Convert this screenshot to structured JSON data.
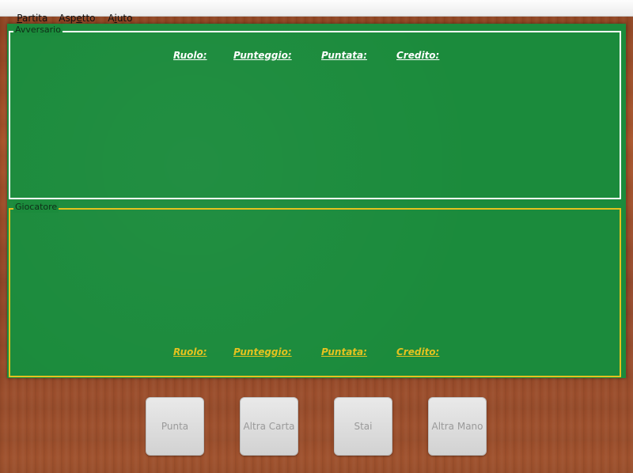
{
  "menu": {
    "partita": {
      "mnemonic": "P",
      "rest": "artita"
    },
    "aspetto": {
      "pre": "Asp",
      "mnemonic": "e",
      "post": "tto"
    },
    "aiuto": {
      "pre": "A",
      "mnemonic": "i",
      "post": "uto"
    }
  },
  "opponent": {
    "title": "Avversario",
    "stats": {
      "ruolo": "Ruolo:",
      "punteggio": "Punteggio:",
      "puntata": "Puntata:",
      "credito": "Credito:"
    }
  },
  "player": {
    "title": "Giocatore",
    "stats": {
      "ruolo": "Ruolo:",
      "punteggio": "Punteggio:",
      "puntata": "Puntata:",
      "credito": "Credito:"
    }
  },
  "buttons": {
    "punta": "Punta",
    "altra_carta": "Altra Carta",
    "stai": "Stai",
    "altra_mano": "Altra Mano"
  },
  "colors": {
    "table_felt": "#1b8b3c",
    "opponent_border": "#ffffff",
    "player_border": "#e4c21f",
    "wood": "#a0522d",
    "disabled_button_text": "#9a9a9a"
  }
}
